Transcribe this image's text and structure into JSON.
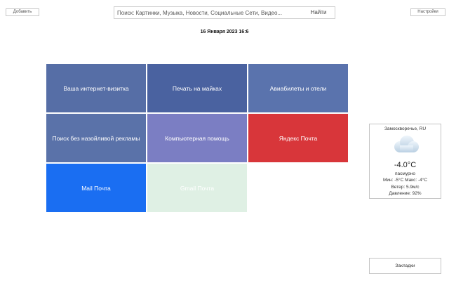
{
  "header": {
    "add_label": "Добавить",
    "settings_label": "Настройки"
  },
  "search": {
    "placeholder": "Поиск: Картинки, Музыка, Новости, Социальные Сети, Видео...",
    "submit_label": "Найти"
  },
  "datetime": "16 Января 2023 16:6",
  "tiles": [
    {
      "label": "Ваша интернет-визитка",
      "color": "#566ea6"
    },
    {
      "label": "Печать на майках",
      "color": "#4a62a0"
    },
    {
      "label": "Авиабилеты и отели",
      "color": "#5a73ad"
    },
    {
      "label": "Поиск без назойливой рекламы",
      "color": "#5a72a9"
    },
    {
      "label": "Компьютерная помощь",
      "color": "#7b7ec3"
    },
    {
      "label": "Яндекс Почта",
      "color": "#d8363a"
    },
    {
      "label": "Mail Почта",
      "color": "#1a6ef2"
    },
    {
      "label": "Gmail Почта",
      "color": "#dff0e4"
    }
  ],
  "weather": {
    "location": "Замоскворечье, RU",
    "icon": "cloud-icon",
    "temperature": "-4.0°C",
    "condition": "пасмурно",
    "min_max": "Мин: -5°C Макс: -4°C",
    "wind": "Ветер: 5.9м/с",
    "pressure": "Давление: 92%"
  },
  "bookmarks_label": "Закладки"
}
